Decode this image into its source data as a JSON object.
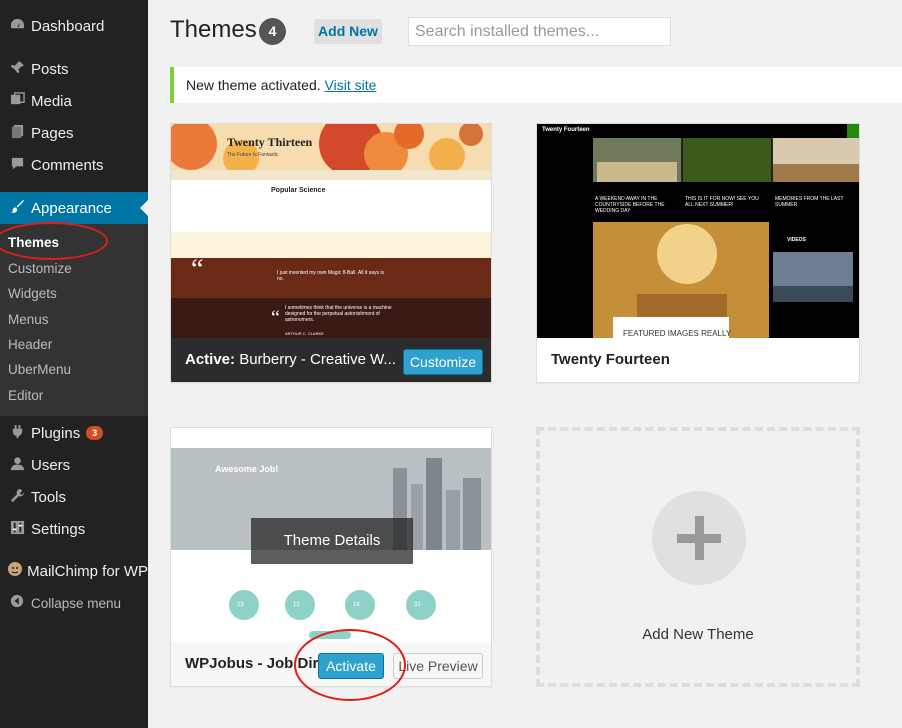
{
  "sidebar": {
    "items": [
      {
        "label": "Dashboard"
      },
      {
        "label": "Posts"
      },
      {
        "label": "Media"
      },
      {
        "label": "Pages"
      },
      {
        "label": "Comments"
      },
      {
        "label": "Appearance"
      },
      {
        "label": "Plugins",
        "badge": "3"
      },
      {
        "label": "Users"
      },
      {
        "label": "Tools"
      },
      {
        "label": "Settings"
      },
      {
        "label": "MailChimp for WP"
      },
      {
        "label": "Collapse menu"
      }
    ],
    "submenu": [
      "Themes",
      "Customize",
      "Widgets",
      "Menus",
      "Header",
      "UberMenu",
      "Editor"
    ]
  },
  "header": {
    "title": "Themes",
    "count": "4",
    "add_new": "Add New",
    "search_placeholder": "Search installed themes..."
  },
  "notice": {
    "text": "New theme activated.",
    "link": "Visit site"
  },
  "themes": {
    "active": {
      "prefix": "Active:",
      "name": "Burberry - Creative W...",
      "customize": "Customize",
      "preview_title": "Twenty Thirteen",
      "preview_tagline": "The Future Is Fantastic",
      "preview_post": "Popular Science",
      "preview_quote1": "I just invented my own Magic 8-Ball. All it says is no.",
      "preview_quote2": "I sometimes think that the universe is a machine designed for the perpetual astonishment of astronomers.",
      "preview_author": "ARTHUR C. CLARKE"
    },
    "fourteen": {
      "name": "Twenty Fourteen",
      "preview_site": "Twenty Fourteen",
      "preview_featured": "FEATURED IMAGES REALLY",
      "preview_videos": "VIDEOS",
      "caption1": "A WEEKEND AWAY IN THE COUNTRYSIDE BEFORE THE WEDDING DAY",
      "caption2": "THIS IS IT FOR NOW! SEE YOU ALL NEXT SUMMER!",
      "caption3": "MEMORIES FROM THE LAST SUMMER"
    },
    "wpjobus": {
      "name": "WPJobus - Job Direct",
      "details": "Theme Details",
      "activate": "Activate",
      "live_preview": "Live Preview",
      "preview_heading": "Awesome Job!",
      "stats": [
        "23",
        "12",
        "18",
        "32"
      ]
    },
    "add_new": "Add New Theme"
  },
  "colors": {
    "sidebar_bg": "#222222",
    "accent": "#0074a2",
    "button_blue": "#2ea2cc",
    "notice_green": "#7ad03a",
    "annotation_red": "#e21b1b"
  }
}
